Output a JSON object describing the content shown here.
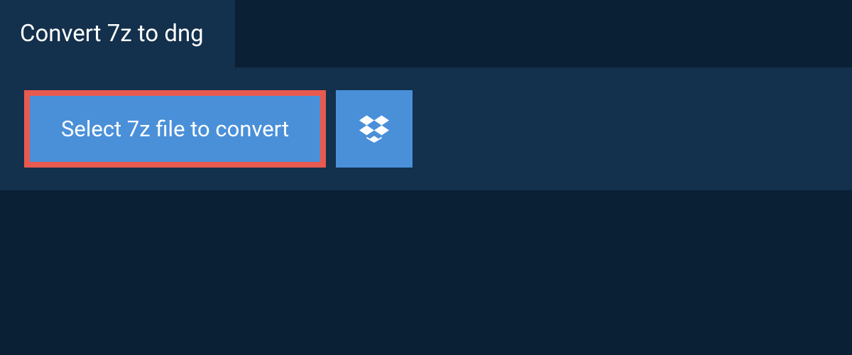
{
  "tab": {
    "title": "Convert 7z to dng"
  },
  "panel": {
    "select_label": "Select 7z file to convert"
  },
  "colors": {
    "bg_dark": "#0a2035",
    "bg_panel": "#13304c",
    "button_blue": "#4a90d9",
    "highlight_border": "#e85a4f"
  }
}
